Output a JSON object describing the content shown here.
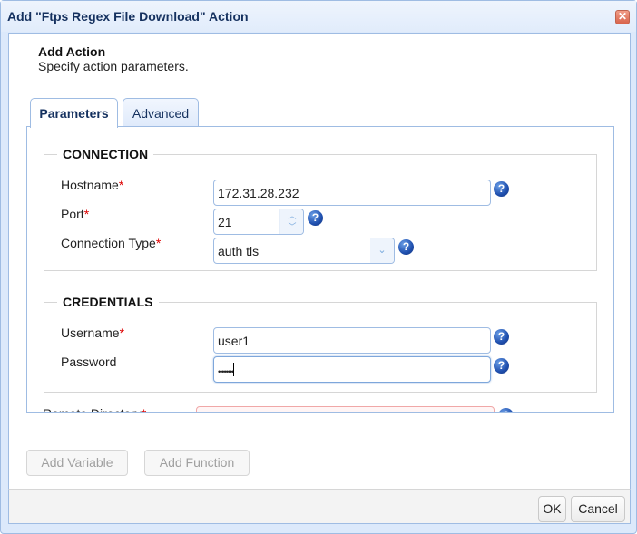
{
  "dialog": {
    "title": "Add \"Ftps Regex File Download\" Action",
    "close_icon": "close-icon"
  },
  "header": {
    "title": "Add Action",
    "subtitle": "Specify action parameters."
  },
  "tabs": [
    {
      "label": "Parameters",
      "active": true
    },
    {
      "label": "Advanced",
      "active": false
    }
  ],
  "connection": {
    "legend": "CONNECTION",
    "hostname": {
      "label": "Hostname",
      "required": "*",
      "value": "172.31.28.232"
    },
    "port": {
      "label": "Port",
      "required": "*",
      "value": "21"
    },
    "connection_type": {
      "label": "Connection Type",
      "required": "*",
      "value": "auth tls"
    }
  },
  "credentials": {
    "legend": "CREDENTIALS",
    "username": {
      "label": "Username",
      "required": "*",
      "value": "user1"
    },
    "password": {
      "label": "Password",
      "value": "••••••••"
    }
  },
  "remote_directory": {
    "label": "Remote Directory",
    "required": "*",
    "value": ""
  },
  "actions": {
    "add_variable": "Add Variable",
    "add_function": "Add Function"
  },
  "footer": {
    "ok": "OK",
    "cancel": "Cancel"
  },
  "icons": {
    "help": "?",
    "close": "✕",
    "spin_up": "︿",
    "spin_down": "﹀",
    "dropdown": "⌄"
  }
}
